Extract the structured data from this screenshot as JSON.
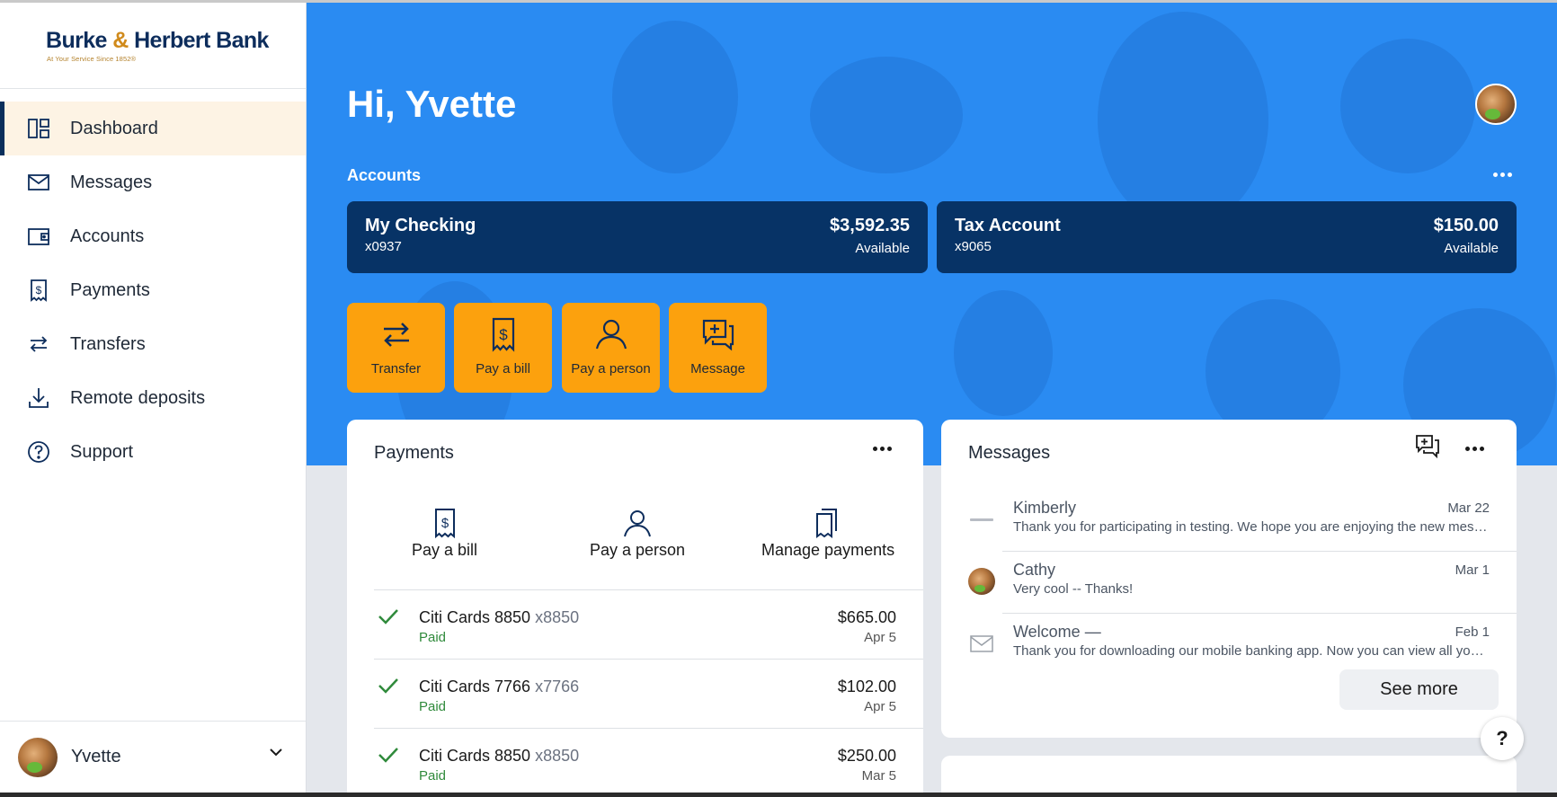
{
  "brand": {
    "name_part1": "Burke",
    "ampersand": "&",
    "name_part2": "Herbert Bank",
    "tagline": "At Your Service Since 1852®"
  },
  "colors": {
    "hero_blue": "#2a8bf2",
    "navy": "#073366",
    "accent_orange": "#fca10d",
    "active_nav_bg": "#fdf3e4",
    "paid_green": "#2f8a3b"
  },
  "sidebar": {
    "items": [
      {
        "label": "Dashboard",
        "icon": "dashboard-icon",
        "active": true
      },
      {
        "label": "Messages",
        "icon": "envelope-icon"
      },
      {
        "label": "Accounts",
        "icon": "wallet-icon"
      },
      {
        "label": "Payments",
        "icon": "bill-icon"
      },
      {
        "label": "Transfers",
        "icon": "transfer-arrows-icon"
      },
      {
        "label": "Remote deposits",
        "icon": "download-icon"
      },
      {
        "label": "Support",
        "icon": "question-circle-icon"
      }
    ],
    "user": {
      "name": "Yvette"
    }
  },
  "header": {
    "greeting": "Hi, Yvette"
  },
  "accounts": {
    "title": "Accounts",
    "list": [
      {
        "name": "My Checking",
        "number": "x0937",
        "balance": "$3,592.35",
        "balance_label": "Available"
      },
      {
        "name": "Tax Account",
        "number": "x9065",
        "balance": "$150.00",
        "balance_label": "Available"
      }
    ]
  },
  "quick_actions": [
    {
      "label": "Transfer",
      "icon": "transfer-arrows-icon"
    },
    {
      "label": "Pay a bill",
      "icon": "bill-icon"
    },
    {
      "label": "Pay a person",
      "icon": "person-icon"
    },
    {
      "label": "Message",
      "icon": "chat-plus-icon"
    }
  ],
  "payments": {
    "title": "Payments",
    "options": [
      {
        "label": "Pay a bill",
        "icon": "bill-icon"
      },
      {
        "label": "Pay a person",
        "icon": "person-icon"
      },
      {
        "label": "Manage payments",
        "icon": "documents-icon"
      }
    ],
    "list": [
      {
        "payee": "Citi Cards 8850",
        "acct": "x8850",
        "status": "Paid",
        "amount": "$665.00",
        "date": "Apr 5"
      },
      {
        "payee": "Citi Cards 7766",
        "acct": "x7766",
        "status": "Paid",
        "amount": "$102.00",
        "date": "Apr 5"
      },
      {
        "payee": "Citi Cards 8850",
        "acct": "x8850",
        "status": "Paid",
        "amount": "$250.00",
        "date": "Mar 5"
      }
    ]
  },
  "messages": {
    "title": "Messages",
    "list": [
      {
        "sender": "Kimberly",
        "date": "Mar 22",
        "preview": "Thank you for participating in testing. We hope you are enjoying the new messaging experience."
      },
      {
        "sender": "Cathy",
        "date": "Mar 1",
        "preview": "Very cool -- Thanks!"
      },
      {
        "sender": "Welcome —",
        "date": "Feb 1",
        "preview": "Thank you for downloading our mobile banking app. Now you can view all your accounts in one place."
      }
    ],
    "see_more": "See more"
  },
  "help": {
    "label": "?"
  }
}
